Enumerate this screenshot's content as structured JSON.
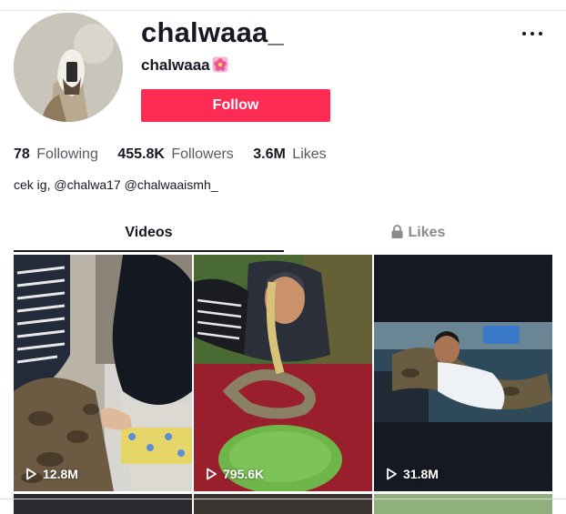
{
  "profile": {
    "username": "chalwaaa_",
    "nickname": "chalwaaa",
    "follow_label": "Follow",
    "bio": "cek ig, @chalwa17 @chalwaaismh_"
  },
  "stats": [
    {
      "value": "78",
      "label": "Following"
    },
    {
      "value": "455.8K",
      "label": "Followers"
    },
    {
      "value": "3.6M",
      "label": "Likes"
    }
  ],
  "tabs": {
    "videos": "Videos",
    "likes": "Likes"
  },
  "videos": [
    {
      "views": "12.8M"
    },
    {
      "views": "795.6K"
    },
    {
      "views": "31.8M"
    }
  ],
  "colors": {
    "accent": "#fe2c55",
    "text": "#161823",
    "muted": "#8a8b91"
  },
  "icons": [
    "more-icon",
    "flower-emoji-icon",
    "lock-icon",
    "play-icon"
  ]
}
